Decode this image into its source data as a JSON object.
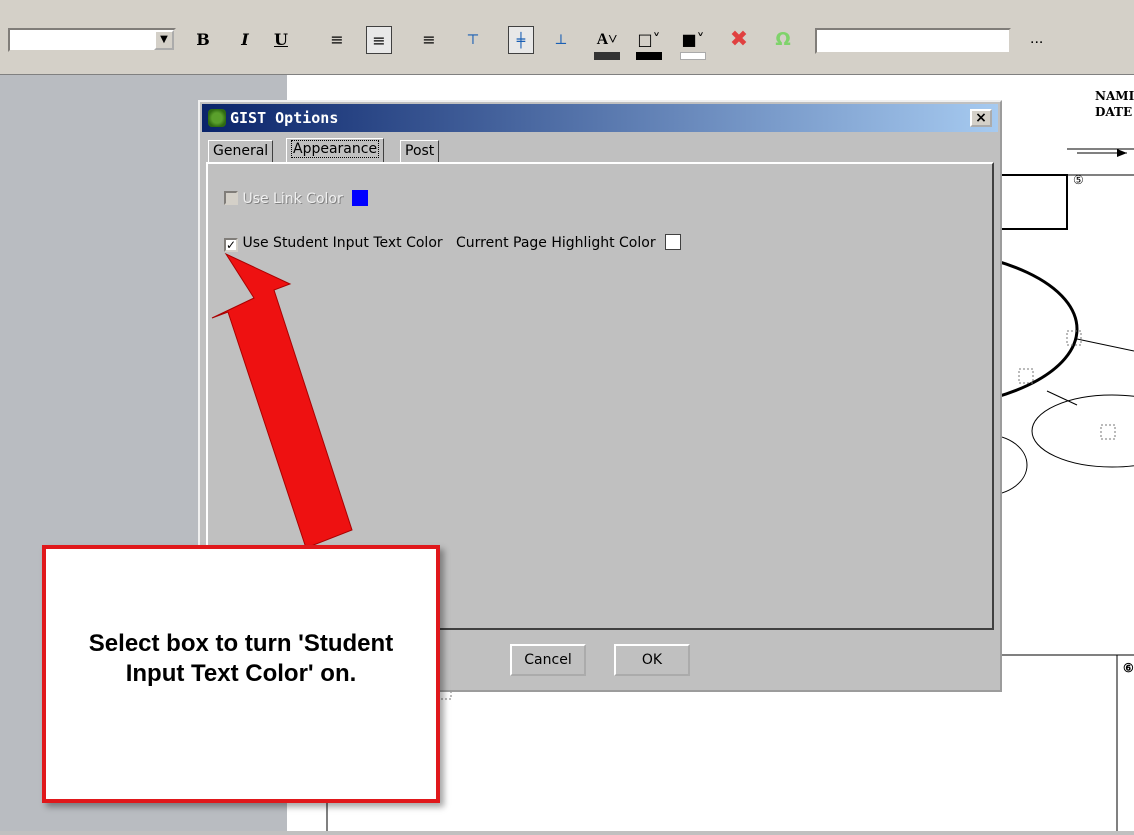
{
  "toolbar": {
    "font_combo_value": "",
    "bold": "B",
    "italic": "I",
    "underline": "U",
    "text_input_value": "",
    "ellipsis": "...",
    "colors": {
      "font_color_swatch": "#333333",
      "border_swatch": "#000000",
      "bg_swatch": "#ffffff"
    }
  },
  "page": {
    "label_name": "NAMI",
    "label_date": "DATE",
    "circle_num_1": "⑤",
    "circle_num_2": "⑥"
  },
  "dialog": {
    "title": "GIST Options",
    "close": "×",
    "tabs": [
      {
        "label": "General"
      },
      {
        "label": "Appearance",
        "active": true
      },
      {
        "label": "Post"
      }
    ],
    "use_link_color": {
      "label": "Use Link Color",
      "checked": false,
      "enabled": false,
      "color": "#0000ff"
    },
    "use_student_input_text_color": {
      "label": "Use Student Input Text Color",
      "checked": true
    },
    "current_page_highlight": {
      "label": "Current Page Highlight Color",
      "color": "#ffffff"
    },
    "cancel_label": "Cancel",
    "ok_label": "OK"
  },
  "callout": {
    "text": "Select box to turn 'Student Input Text Color' on."
  }
}
